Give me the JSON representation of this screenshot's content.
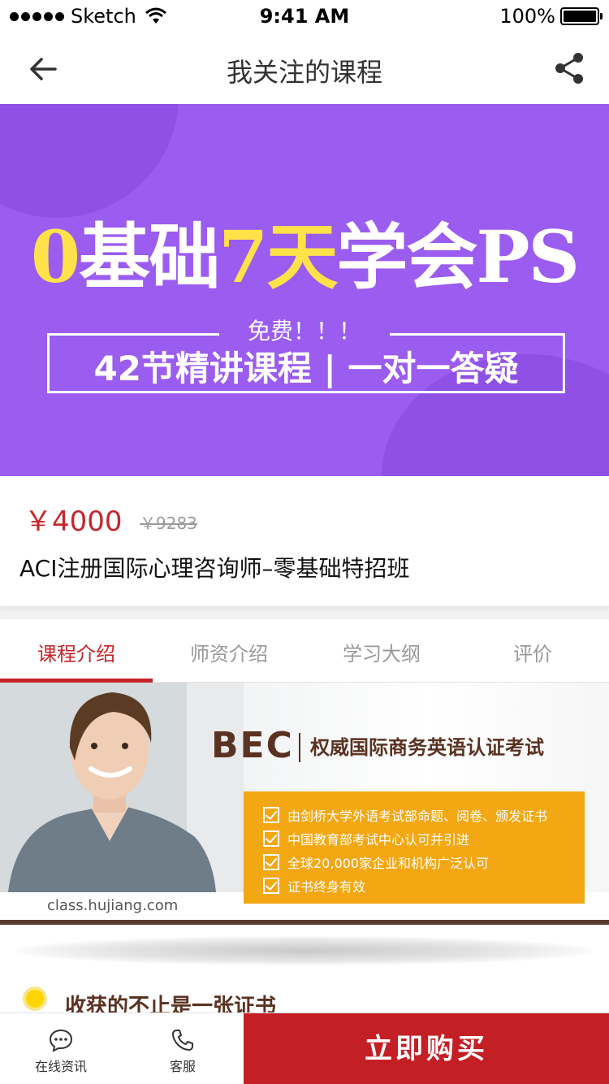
{
  "status_bar": {
    "carrier": "Sketch",
    "time": "9:41 AM",
    "battery": "100%"
  },
  "nav": {
    "title": "我关注的课程",
    "back_icon": "arrow-left-icon",
    "share_icon": "share-icon"
  },
  "hero": {
    "headline_part1": "0",
    "headline_part2": "基础",
    "headline_part3": "7天",
    "headline_part4": "学会PS",
    "free_label": "免费！！！",
    "subline": "42节精讲课程 | 一对一答疑"
  },
  "course": {
    "price": "￥4000",
    "original_price": "￥9283",
    "title": "ACI注册国际心理咨询师–零基础特招班"
  },
  "tabs": [
    {
      "label": "课程介绍",
      "active": true
    },
    {
      "label": "师资介绍",
      "active": false
    },
    {
      "label": "学习大纲",
      "active": false
    },
    {
      "label": "评价",
      "active": false
    }
  ],
  "bec": {
    "logo": "BEC",
    "tagline": "权威国际商务英语认证考试",
    "items": [
      "由剑桥大学外语考试部命题、阅卷、颁发证书",
      "中国教育部考试中心认可并引进",
      "全球20,000家企业和机构广泛认可",
      "证书终身有效"
    ],
    "url": "class.hujiang.com"
  },
  "bonus": {
    "title": "收获的不止是一张证书"
  },
  "bottom_bar": {
    "consult_label": "在线资讯",
    "service_label": "客服",
    "buy_label": "立即购买"
  },
  "colors": {
    "accent": "#c8242b",
    "hero_bg": "#9b5cf0",
    "hero_highlight": "#ffe14a",
    "bec_box": "#f3a712",
    "bec_brown": "#5a3222"
  }
}
